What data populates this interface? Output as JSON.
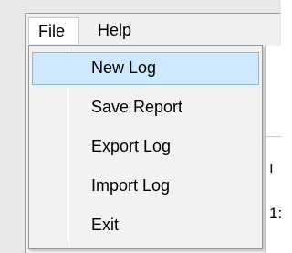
{
  "menubar": {
    "file_label": "File",
    "help_label": "Help"
  },
  "file_menu": {
    "items": [
      {
        "label": "New Log",
        "highlighted": true
      },
      {
        "label": "Save Report",
        "highlighted": false
      },
      {
        "label": "Export Log",
        "highlighted": false
      },
      {
        "label": "Import Log",
        "highlighted": false
      },
      {
        "label": "Exit",
        "highlighted": false
      }
    ]
  },
  "background": {
    "peek_text_1": "ı",
    "peek_text_2": "1:"
  },
  "colors": {
    "highlight_fill": "#cde8ff",
    "highlight_border": "#84b9e5",
    "menu_background": "#f2f2f2"
  }
}
